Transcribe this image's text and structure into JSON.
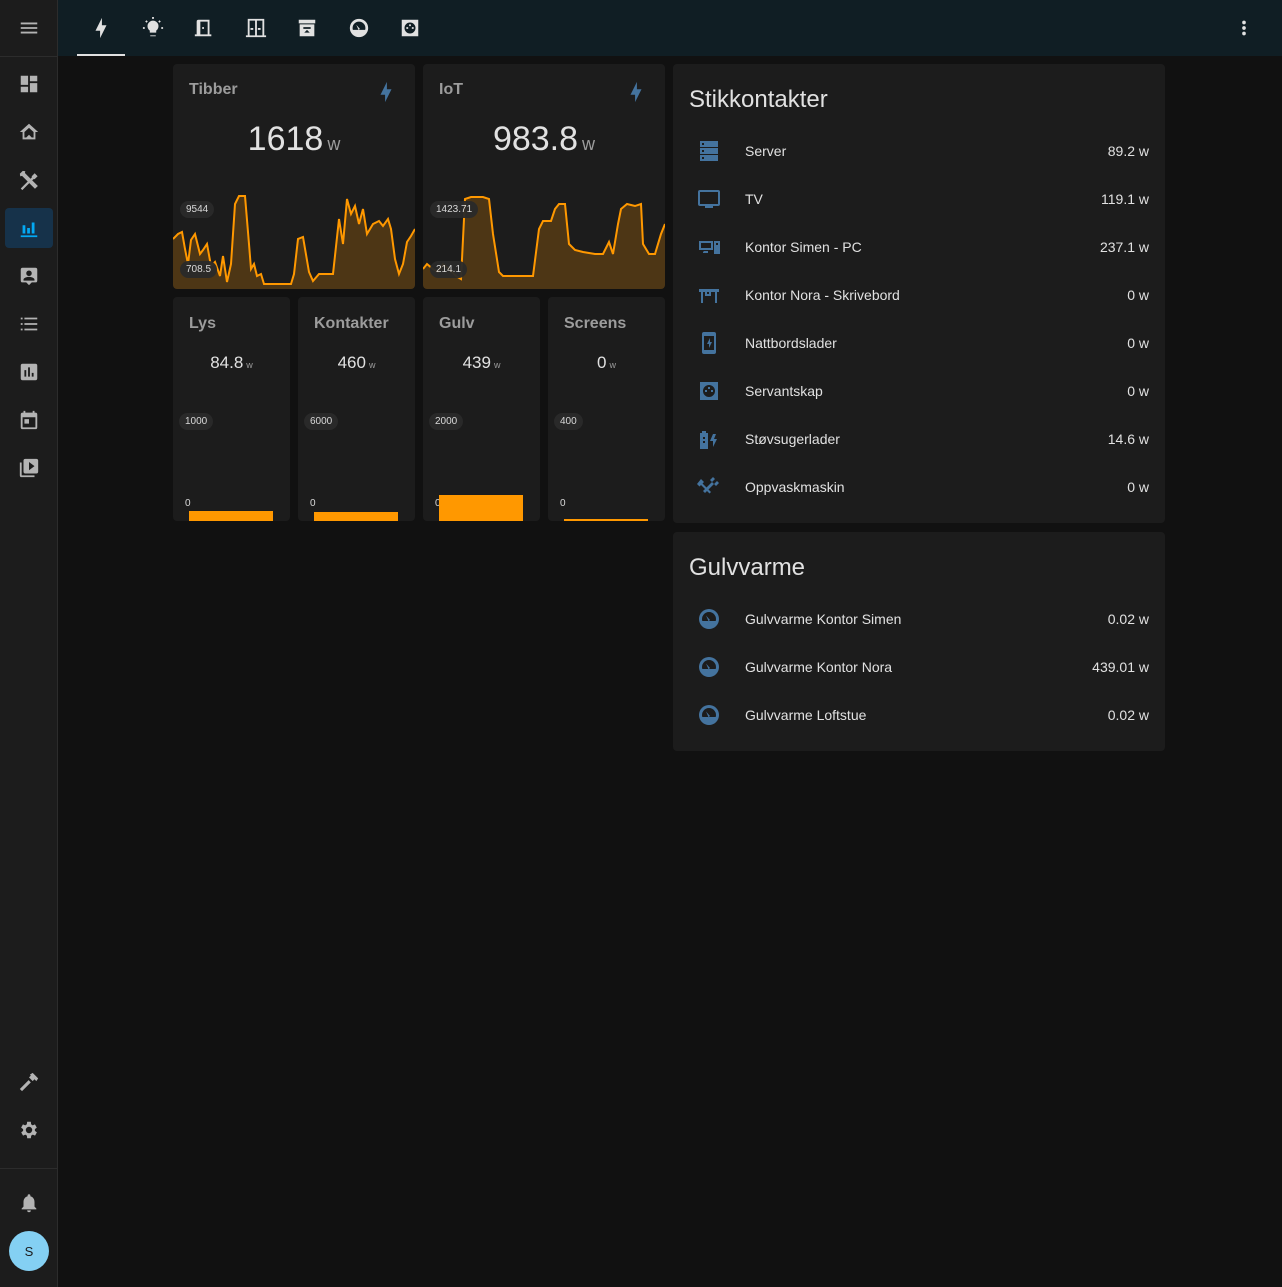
{
  "sidebar": {
    "items": [
      {
        "icon": "menu-icon"
      },
      {
        "icon": "dashboard-icon"
      },
      {
        "icon": "home-icon"
      },
      {
        "icon": "tools-icon"
      },
      {
        "icon": "energy-chart-icon"
      },
      {
        "icon": "contacts-icon"
      },
      {
        "icon": "list-icon"
      },
      {
        "icon": "history-icon"
      },
      {
        "icon": "calendar-icon"
      },
      {
        "icon": "media-icon"
      }
    ],
    "bottom": [
      {
        "icon": "hammer-icon"
      },
      {
        "icon": "gear-icon"
      },
      {
        "icon": "bell-icon"
      }
    ],
    "avatar_initial": "S",
    "active_color": "#03a9f4"
  },
  "header": {
    "tabs": [
      {
        "icon": "lightning-icon",
        "active": true
      },
      {
        "icon": "lightbulb-icon"
      },
      {
        "icon": "door-icon"
      },
      {
        "icon": "window-icon"
      },
      {
        "icon": "archive-icon"
      },
      {
        "icon": "gauge-icon"
      },
      {
        "icon": "power-socket-icon"
      }
    ],
    "menu_icon": "dots-vertical-icon"
  },
  "cards": {
    "tibber": {
      "name": "Tibber",
      "value": "1618",
      "unit": "w",
      "max": "9544",
      "min": "708.5"
    },
    "iot": {
      "name": "IoT",
      "value": "983.8",
      "unit": "w",
      "max": "1423.71",
      "min": "214.1"
    },
    "lys": {
      "name": "Lys",
      "value": "84.8",
      "unit": "w",
      "max": "1000",
      "min": "0",
      "fraction": 0.0848
    },
    "kontakter": {
      "name": "Kontakter",
      "value": "460",
      "unit": "w",
      "max": "6000",
      "min": "0",
      "fraction": 0.0767
    },
    "gulv": {
      "name": "Gulv",
      "value": "439",
      "unit": "w",
      "max": "2000",
      "min": "0",
      "fraction": 0.2195
    },
    "screens": {
      "name": "Screens",
      "value": "0",
      "unit": "w",
      "max": "400",
      "min": "0",
      "fraction": 0.0
    }
  },
  "stikkontakter": {
    "title": "Stikkontakter",
    "rows": [
      {
        "icon": "server-icon",
        "name": "Server",
        "value": "89.2 w"
      },
      {
        "icon": "tv-icon",
        "name": "TV",
        "value": "119.1 w"
      },
      {
        "icon": "desktop-pc-icon",
        "name": "Kontor Simen - PC",
        "value": "237.1 w"
      },
      {
        "icon": "desk-icon",
        "name": "Kontor Nora - Skrivebord",
        "value": "0 w"
      },
      {
        "icon": "phone-charging-icon",
        "name": "Nattbordslader",
        "value": "0 w"
      },
      {
        "icon": "power-socket-icon",
        "name": "Servantskap",
        "value": "0 w"
      },
      {
        "icon": "battery-charging-icon",
        "name": "Støvsugerlader",
        "value": "14.6 w"
      },
      {
        "icon": "dishwasher-icon",
        "name": "Oppvaskmaskin",
        "value": "0 w"
      }
    ]
  },
  "gulvvarme": {
    "title": "Gulvvarme",
    "rows": [
      {
        "icon": "gauge-icon",
        "name": "Gulvvarme Kontor Simen",
        "value": "0.02 w"
      },
      {
        "icon": "gauge-icon",
        "name": "Gulvvarme Kontor Nora",
        "value": "439.01 w"
      },
      {
        "icon": "gauge-icon",
        "name": "Gulvvarme Loftstue",
        "value": "0.02 w"
      }
    ]
  },
  "colors": {
    "accent": "#ff9800",
    "icon": "#44739e",
    "card": "#1c1c1c",
    "background": "#111111"
  }
}
